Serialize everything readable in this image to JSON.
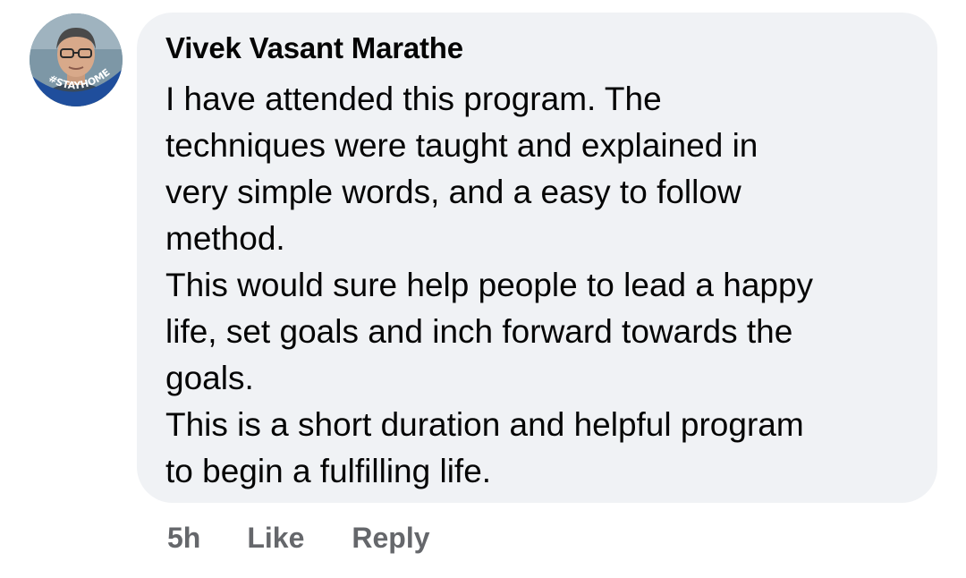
{
  "comment": {
    "author": "Vivek Vasant Marathe",
    "avatar_badge": "#STAYHOME",
    "lines": [
      "I have attended this program. The",
      "techniques were taught and explained in",
      "very simple words, and a easy to follow",
      "method.",
      "This would sure help people to lead a happy",
      "life, set goals and inch forward towards the",
      "goals.",
      "This is a short duration and helpful program",
      "to begin a fulfilling life."
    ],
    "timestamp": "5h",
    "like_label": "Like",
    "reply_label": "Reply"
  },
  "colors": {
    "bubble_bg": "#f0f2f5",
    "text": "#050505",
    "secondary": "#65676b",
    "badge": "#1f4e9c"
  }
}
